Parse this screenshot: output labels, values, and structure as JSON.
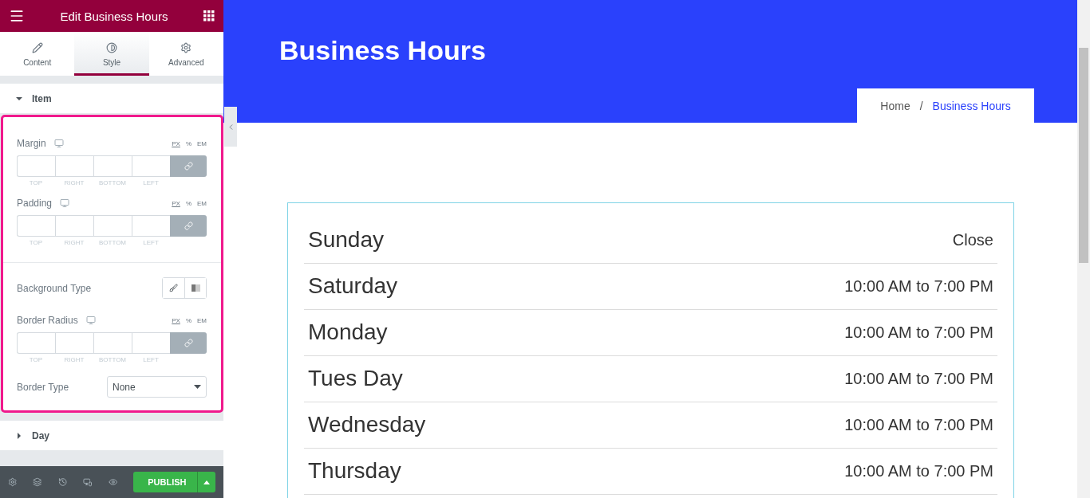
{
  "panel": {
    "title": "Edit Business Hours",
    "tabs": [
      {
        "label": "Content",
        "selected": false
      },
      {
        "label": "Style",
        "selected": true
      },
      {
        "label": "Advanced",
        "selected": false
      }
    ],
    "sections": [
      {
        "title": "Item",
        "expanded": true,
        "controls": [
          {
            "kind": "dimensions",
            "label": "Margin",
            "units": [
              {
                "label": "PX",
                "selected": true
              },
              {
                "label": "%",
                "selected": false
              },
              {
                "label": "EM",
                "selected": false
              }
            ],
            "sides": [
              "TOP",
              "RIGHT",
              "BOTTOM",
              "LEFT"
            ]
          },
          {
            "kind": "dimensions",
            "label": "Padding",
            "units": [
              {
                "label": "PX",
                "selected": true
              },
              {
                "label": "%",
                "selected": false
              },
              {
                "label": "EM",
                "selected": false
              }
            ],
            "sides": [
              "TOP",
              "RIGHT",
              "BOTTOM",
              "LEFT"
            ]
          },
          {
            "kind": "divider"
          },
          {
            "kind": "background",
            "label": "Background Type",
            "options": [
              {
                "kind": "classic",
                "selected": false
              },
              {
                "kind": "gradient",
                "selected": false
              }
            ]
          },
          {
            "kind": "dimensions",
            "label": "Border Radius",
            "units": [
              {
                "label": "PX",
                "selected": true
              },
              {
                "label": "%",
                "selected": false
              },
              {
                "label": "EM",
                "selected": false
              }
            ],
            "sides": [
              "TOP",
              "RIGHT",
              "BOTTOM",
              "LEFT"
            ]
          },
          {
            "kind": "select",
            "label": "Border Type",
            "value": "None"
          }
        ]
      },
      {
        "title": "Day",
        "expanded": false
      }
    ],
    "footer": {
      "publish": "PUBLISH"
    }
  },
  "page": {
    "title": "Business Hours",
    "breadcrumb": [
      {
        "label": "Home",
        "selected": false
      },
      {
        "label": "Business Hours",
        "selected": true
      }
    ],
    "separator": "/",
    "hours": [
      {
        "day": "Sunday",
        "time": "Close"
      },
      {
        "day": "Saturday",
        "time": "10:00 AM to 7:00 PM"
      },
      {
        "day": "Monday",
        "time": "10:00 AM to 7:00 PM"
      },
      {
        "day": "Tues Day",
        "time": "10:00 AM to 7:00 PM"
      },
      {
        "day": "Wednesday",
        "time": "10:00 AM to 7:00 PM"
      },
      {
        "day": "Thursday",
        "time": "10:00 AM to 7:00 PM"
      }
    ]
  }
}
